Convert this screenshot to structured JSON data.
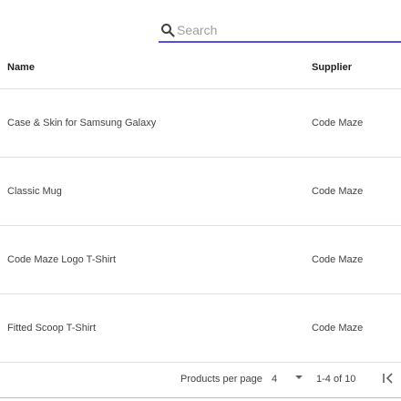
{
  "search": {
    "placeholder": "Search",
    "value": ""
  },
  "table": {
    "columns": {
      "name": "Name",
      "supplier": "Supplier"
    },
    "rows": [
      {
        "name": "Case & Skin for Samsung Galaxy",
        "supplier": "Code Maze"
      },
      {
        "name": "Classic Mug",
        "supplier": "Code Maze"
      },
      {
        "name": "Code Maze Logo T-Shirt",
        "supplier": "Code Maze"
      },
      {
        "name": "Fitted Scoop T-Shirt",
        "supplier": "Code Maze"
      }
    ]
  },
  "pager": {
    "per_page_label": "Products per page",
    "per_page_value": "4",
    "range": "1-4 of 10"
  },
  "colors": {
    "accent": "#594ae2"
  }
}
